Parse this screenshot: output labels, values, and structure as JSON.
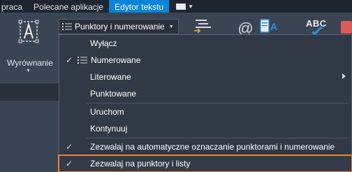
{
  "tabs": [
    {
      "label": "praca",
      "active": false
    },
    {
      "label": "Polecane aplikacje",
      "active": false
    },
    {
      "label": "Edytor tekstu",
      "active": true
    }
  ],
  "ribbon": {
    "align_label": "Wyrównanie",
    "bullets_button_label": "Punktory i numerowanie",
    "spell_label": "ABC"
  },
  "menu": {
    "items": [
      {
        "label": "Wyłącz",
        "checked": false
      },
      {
        "label": "Numerowane",
        "checked": true,
        "icon": "numbered-list-icon"
      },
      {
        "label": "Literowane",
        "checked": false,
        "submenu": true
      },
      {
        "label": "Punktowane",
        "checked": false
      },
      {
        "label": "Uruchom",
        "checked": false
      },
      {
        "label": "Kontynuuj",
        "checked": false
      },
      {
        "label": "Zezwalaj na automatyczne oznaczanie punktorami i numerowanie",
        "checked": true
      },
      {
        "label": "Zezwalaj na punktory i listy",
        "checked": true,
        "highlighted": true
      }
    ],
    "check_glyph": "✓"
  },
  "colors": {
    "active_tab": "#0a84d8",
    "highlight_border": "#e9852b",
    "menu_bg": "#323946",
    "ribbon_bg": "#3b4453"
  }
}
